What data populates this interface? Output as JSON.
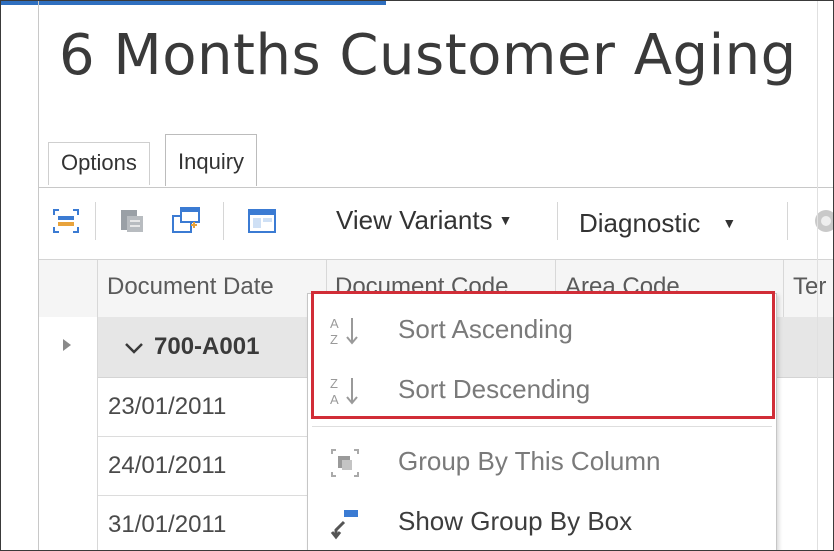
{
  "page": {
    "title": "6 Months Customer Aging"
  },
  "tabs": [
    {
      "label": "Options"
    },
    {
      "label": "Inquiry"
    }
  ],
  "toolbar": {
    "view_variants_label": "View Variants",
    "diagnostic_label": "Diagnostic"
  },
  "grid": {
    "columns": [
      "Document Date",
      "Document Code",
      "Area Code",
      "Ter"
    ],
    "group_label": "700-A001",
    "rows": [
      {
        "document_date": "23/01/2011"
      },
      {
        "document_date": "24/01/2011"
      },
      {
        "document_date": "31/01/2011"
      }
    ]
  },
  "context_menu": {
    "items": [
      {
        "label": "Sort Ascending",
        "icon": "sort-ascending-icon"
      },
      {
        "label": "Sort Descending",
        "icon": "sort-descending-icon"
      },
      {
        "label": "Group By This Column",
        "icon": "group-by-column-icon"
      },
      {
        "label": "Show Group By Box",
        "icon": "show-group-by-box-icon"
      }
    ]
  },
  "colors": {
    "highlight": "#d12d37",
    "accent": "#2f6fbf"
  }
}
